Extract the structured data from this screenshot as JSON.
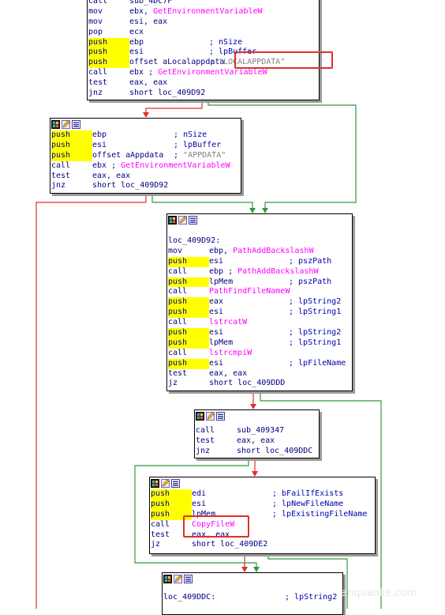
{
  "blocks": {
    "b1": {
      "rows": [
        {
          "op": "call",
          "a1": "sub_4DC7F",
          "a2": ""
        },
        {
          "op": "mov",
          "a1": "ebx, ",
          "api": "GetEnvironmentVariableW"
        },
        {
          "op": "mov",
          "a1": "esi, eax"
        },
        {
          "op": "pop",
          "a1": "ecx"
        },
        {
          "op": "push",
          "a1": "ebp",
          "cmt": "; nSize"
        },
        {
          "op": "push",
          "a1": "esi",
          "cmt": "; lpBuffer"
        },
        {
          "op": "push",
          "a1": "offset aLocalappdata",
          "cmt": "; \"LOCALAPPDATA\""
        },
        {
          "op": "call",
          "a1": "ebx ; ",
          "api": "GetEnvironmentVariableW"
        },
        {
          "op": "test",
          "a1": "eax, eax"
        },
        {
          "op": "jnz",
          "a1": "short loc_409D92"
        }
      ]
    },
    "b2": {
      "rows": [
        {
          "op": "push",
          "a1": "ebp",
          "cmt": "; nSize"
        },
        {
          "op": "push",
          "a1": "esi",
          "cmt": "; lpBuffer"
        },
        {
          "op": "push",
          "a1": "offset aAppdata",
          "cmt": "; \"APPDATA\""
        },
        {
          "op": "call",
          "a1": "ebx ; ",
          "api": "GetEnvironmentVariableW"
        },
        {
          "op": "test",
          "a1": "eax, eax"
        },
        {
          "op": "jnz",
          "a1": "short loc_409D92"
        }
      ]
    },
    "b3": {
      "label": "loc_409D92:",
      "rows": [
        {
          "op": "mov",
          "a1": "ebp, ",
          "api": "PathAddBackslashW"
        },
        {
          "op": "push",
          "a1": "esi",
          "cmt": "; pszPath"
        },
        {
          "op": "call",
          "a1": "ebp ; ",
          "api": "PathAddBackslashW"
        },
        {
          "op": "push",
          "a1": "lpMem",
          "cmt": "; pszPath"
        },
        {
          "op": "call",
          "a1": "",
          "api": "PathFindFileNameW"
        },
        {
          "op": "push",
          "a1": "eax",
          "cmt": "; lpString2"
        },
        {
          "op": "push",
          "a1": "esi",
          "cmt": "; lpString1"
        },
        {
          "op": "call",
          "a1": "",
          "api": "lstrcatW"
        },
        {
          "op": "push",
          "a1": "esi",
          "cmt": "; lpString2"
        },
        {
          "op": "push",
          "a1": "lpMem",
          "cmt": "; lpString1"
        },
        {
          "op": "call",
          "a1": "",
          "api": "lstrcmpiW"
        },
        {
          "op": "push",
          "a1": "esi",
          "cmt": "; lpFileName"
        },
        {
          "op": "test",
          "a1": "eax, eax"
        },
        {
          "op": "jz",
          "a1": "short loc_409DDD"
        }
      ]
    },
    "b4": {
      "rows": [
        {
          "op": "call",
          "a1": "sub_409347"
        },
        {
          "op": "test",
          "a1": "eax, eax"
        },
        {
          "op": "jnz",
          "a1": "short loc_409DDC"
        }
      ]
    },
    "b5": {
      "rows": [
        {
          "op": "push",
          "a1": "edi",
          "cmt": "; bFailIfExists"
        },
        {
          "op": "push",
          "a1": "esi",
          "cmt": "; lpNewFileName"
        },
        {
          "op": "push",
          "a1": "lpMem",
          "cmt": "; lpExistingFileName"
        },
        {
          "op": "call",
          "a1": "",
          "api": "CopyFileW"
        },
        {
          "op": "test",
          "a1": "eax, eax"
        },
        {
          "op": "jz",
          "a1": "short loc_409DE2"
        }
      ]
    },
    "b6": {
      "rows": [
        {
          "op": "loc_409DDC:",
          "a1": "",
          "cmt": "; lpString2"
        }
      ]
    }
  },
  "colors": {
    "true_edge": "#2f9a45",
    "false_edge": "#e0302a",
    "highlight_box": "#e0302a",
    "api": "#ff00ff",
    "push_bg": "#ffff00"
  },
  "icons": [
    "graph-color-icon",
    "pencil-icon",
    "node-list-icon"
  ],
  "watermark": "anquanke.com"
}
